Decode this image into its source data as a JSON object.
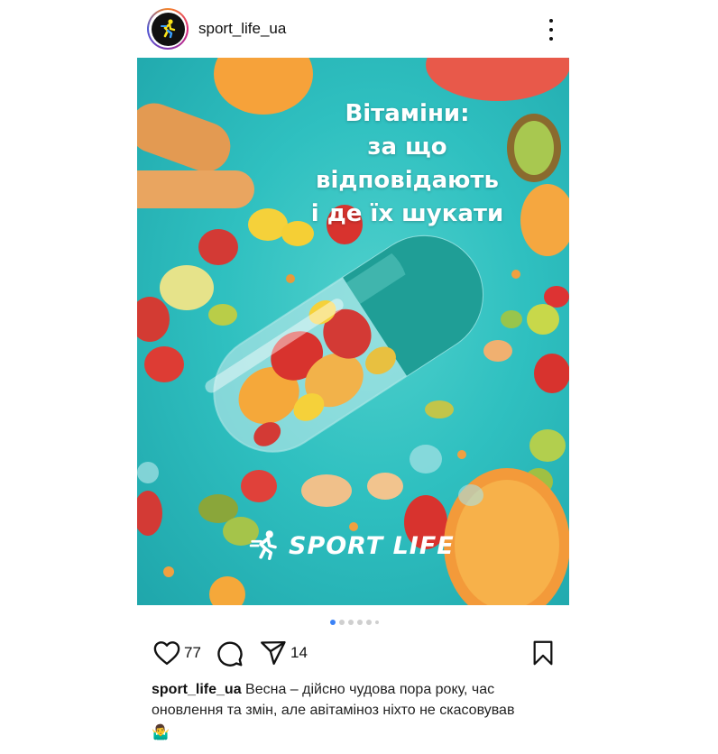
{
  "post": {
    "username": "sport_life_ua",
    "image": {
      "title_lines": [
        "Вітаміни:",
        "за що відповідають",
        "і де їх шукати"
      ],
      "brand": "SPORT LIFE"
    },
    "carousel": {
      "total_dots": 6,
      "active_index": 0
    },
    "likes": "77",
    "shares": "14",
    "caption": {
      "username": "sport_life_ua",
      "text": "Весна – дійсно чудова пора року, час оновлення та змін, але авітаміноз ніхто не скасовував",
      "emoji": "🤷‍♂️"
    }
  },
  "colors": {
    "accent_dot": "#3b82f6",
    "photo_bg": "#2fc0c0",
    "capsule": "#1fa59c"
  },
  "icons": {
    "more": "more-vertical-icon",
    "like": "heart-icon",
    "comment": "comment-icon",
    "share": "send-icon",
    "save": "bookmark-icon"
  }
}
